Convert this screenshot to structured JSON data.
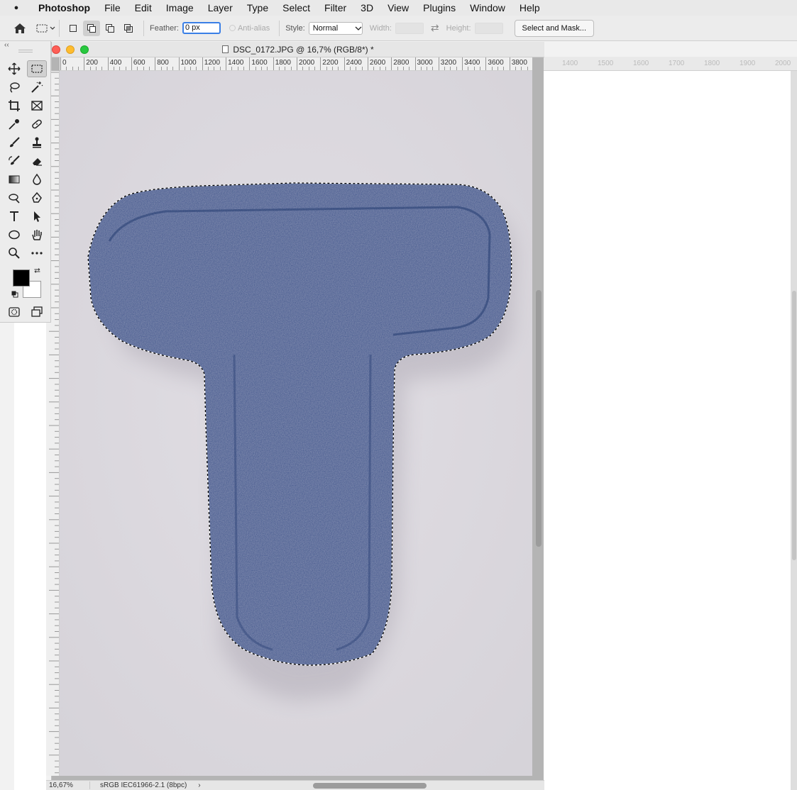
{
  "menubar": {
    "app_name": "Photoshop",
    "items": [
      "File",
      "Edit",
      "Image",
      "Layer",
      "Type",
      "Select",
      "Filter",
      "3D",
      "View",
      "Plugins",
      "Window",
      "Help"
    ]
  },
  "options": {
    "feather_label": "Feather:",
    "feather_value": "0 px",
    "antialias_label": "Anti-alias",
    "style_label": "Style:",
    "style_value": "Normal",
    "width_label": "Width:",
    "height_label": "Height:",
    "mask_button": "Select and Mask..."
  },
  "document": {
    "title": "DSC_0172.JPG @ 16,7% (RGB/8*) *",
    "zoom": "16,67%",
    "color_profile": "sRGB IEC61966-2.1 (8bpc)",
    "status_arrow": "›",
    "h_ruler_labels": [
      "0",
      "200",
      "400",
      "600",
      "800",
      "1000",
      "1200",
      "1400",
      "1600",
      "1800",
      "2000",
      "2200",
      "2400",
      "2600",
      "2800",
      "3000",
      "3200",
      "3400",
      "3600",
      "3800"
    ]
  },
  "background_doc": {
    "ruler_labels": [
      "1400",
      "1500",
      "1600",
      "1700",
      "1800",
      "1900",
      "2000"
    ]
  },
  "tools_panel": {
    "collapse": "‹‹",
    "tools": [
      "move-tool",
      "rectangular-marquee-tool",
      "lasso-tool",
      "magic-wand-tool",
      "crop-tool",
      "frame-tool",
      "eyedropper-tool",
      "healing-brush-tool",
      "brush-tool",
      "clone-stamp-tool",
      "history-brush-tool",
      "eraser-tool",
      "gradient-tool",
      "blur-tool",
      "dodge-tool",
      "pen-tool",
      "type-tool",
      "path-selection-tool",
      "ellipse-tool",
      "hand-tool",
      "zoom-tool",
      "more-tools",
      "quick-mask-mode",
      "screen-mode"
    ],
    "active_tool": "rectangular-marquee-tool",
    "foreground_color": "#000000",
    "background_color": "#ffffff"
  },
  "colors": {
    "felt_blue": "#34508a",
    "canvas_bg": "#dcd9df"
  }
}
